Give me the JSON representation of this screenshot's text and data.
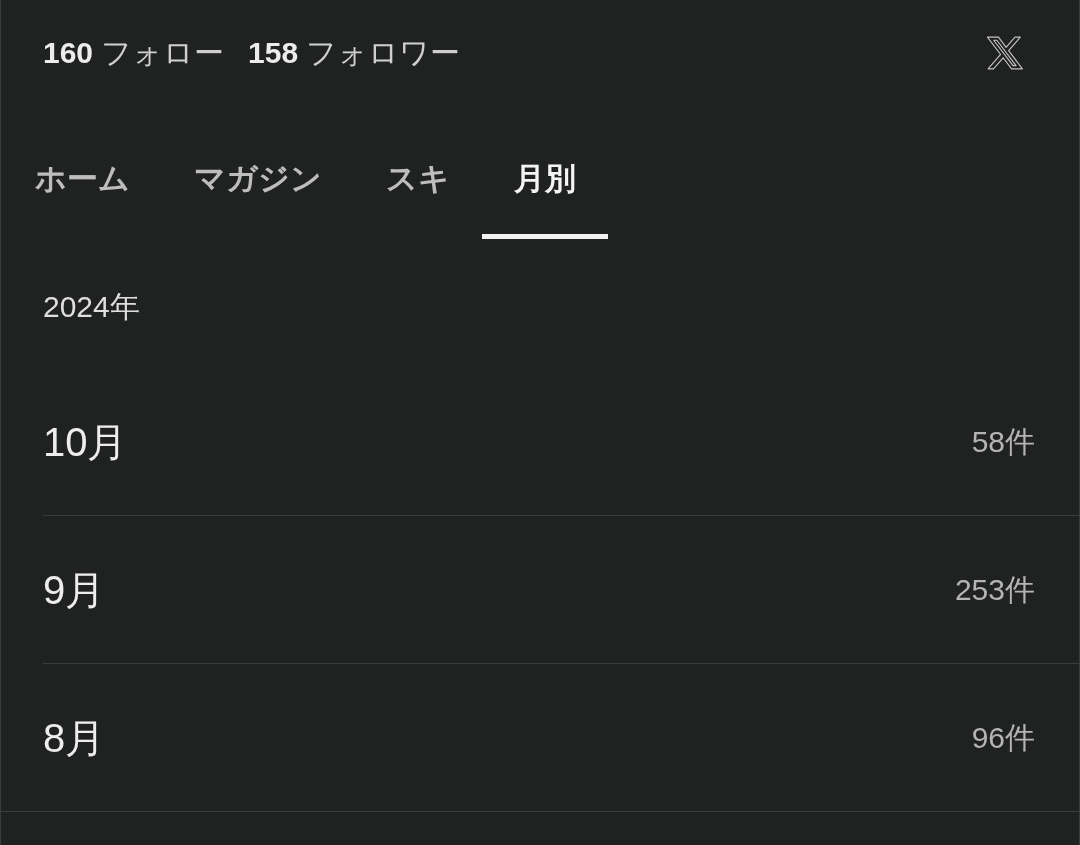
{
  "header": {
    "stats": [
      {
        "count": "160",
        "label": "フォロー"
      },
      {
        "count": "158",
        "label": "フォロワー"
      }
    ]
  },
  "tabs": [
    {
      "label": "ホーム",
      "selected": false
    },
    {
      "label": "マガジン",
      "selected": false
    },
    {
      "label": "スキ",
      "selected": false
    },
    {
      "label": "月別",
      "selected": true
    }
  ],
  "archive": {
    "year": "2024年",
    "months": [
      {
        "month": "10月",
        "count": "58件"
      },
      {
        "month": "9月",
        "count": "253件"
      },
      {
        "month": "8月",
        "count": "96件"
      }
    ]
  }
}
